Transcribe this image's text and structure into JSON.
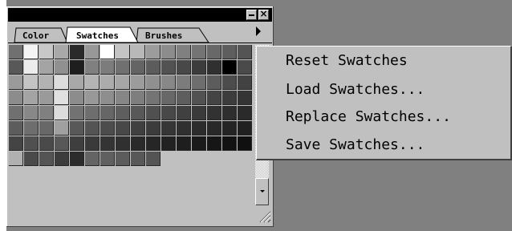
{
  "palette": {
    "tabs": [
      {
        "label": "Color",
        "active": false
      },
      {
        "label": "Swatches",
        "active": true
      },
      {
        "label": "Brushes",
        "active": false
      }
    ],
    "title_buttons": {
      "minimize": "minimize-icon",
      "close": "close-icon"
    },
    "flyout_icon": "triangle-right-icon",
    "swatch_rows": [
      [
        "#707070",
        "#f4f4f4",
        "#c8c8c8",
        "#a8a8a8",
        "#2a2a2a",
        "#989898",
        "#ffffff",
        "#c4c4c4",
        "#b8b8b8",
        "#9c9c9c",
        "#8c8c8c",
        "#808080",
        "#747474",
        "#686868",
        "#5e5e5e",
        "#545454"
      ],
      [
        "#585858",
        "#ececec",
        "#a4a4a4",
        "#909090",
        "#1e1e1e",
        "#808080",
        "#7c7c7c",
        "#707070",
        "#646464",
        "#5c5c5c",
        "#525252",
        "#484848",
        "#3c3c3c",
        "#303030",
        "#000000",
        "#4a4a4a"
      ],
      [
        "#9a9a9a",
        "#c4c4c4",
        "#b2b2b2",
        "#dcdcdc",
        "#a8a8a8",
        "#b4b4b4",
        "#acacac",
        "#a6a6a6",
        "#9c9c9c",
        "#909090",
        "#888888",
        "#7c7c7c",
        "#6e6e6e",
        "#5c5c5c",
        "#4c4c4c",
        "#424242"
      ],
      [
        "#8c8c8c",
        "#a4a4a4",
        "#9a9a9a",
        "#e0e0e0",
        "#8c8c8c",
        "#989898",
        "#8e8e8e",
        "#868686",
        "#7e7e7e",
        "#747474",
        "#686868",
        "#5e5e5e",
        "#525252",
        "#444444",
        "#3c3c3c",
        "#343434"
      ],
      [
        "#707070",
        "#888888",
        "#808080",
        "#dcdcdc",
        "#727272",
        "#6e6e6e",
        "#666666",
        "#5e5e5e",
        "#585858",
        "#505050",
        "#484848",
        "#404040",
        "#3a3a3a",
        "#323232",
        "#2e2e2e",
        "#2a2a2a"
      ],
      [
        "#5c5c5c",
        "#6e6e6e",
        "#686868",
        "#a0a0a0",
        "#585858",
        "#545454",
        "#4c4c4c",
        "#484848",
        "#404040",
        "#3c3c3c",
        "#363636",
        "#303030",
        "#2c2c2c",
        "#282828",
        "#242424",
        "#202020"
      ],
      [
        "#444444",
        "#505050",
        "#4a4a4a",
        "#585858",
        "#3e3e3e",
        "#3a3a3a",
        "#343434",
        "#303030",
        "#2a2a2a",
        "#262626",
        "#222222",
        "#1e1e1e",
        "#1a1a1a",
        "#161616",
        "#121212",
        "#101010"
      ],
      [
        "#b0b0b0",
        "#4a4a4a",
        "#545454",
        "#3c3c3c",
        "#2c2c2c",
        "#646464",
        "#606060",
        "#5c5c5c",
        "#585858",
        "#545454"
      ]
    ],
    "scrollbar": {
      "down_icon": "arrow-down-icon"
    }
  },
  "context_menu": {
    "items": [
      "Reset Swatches",
      "Load Swatches...",
      "Replace Swatches...",
      "Save Swatches..."
    ]
  }
}
